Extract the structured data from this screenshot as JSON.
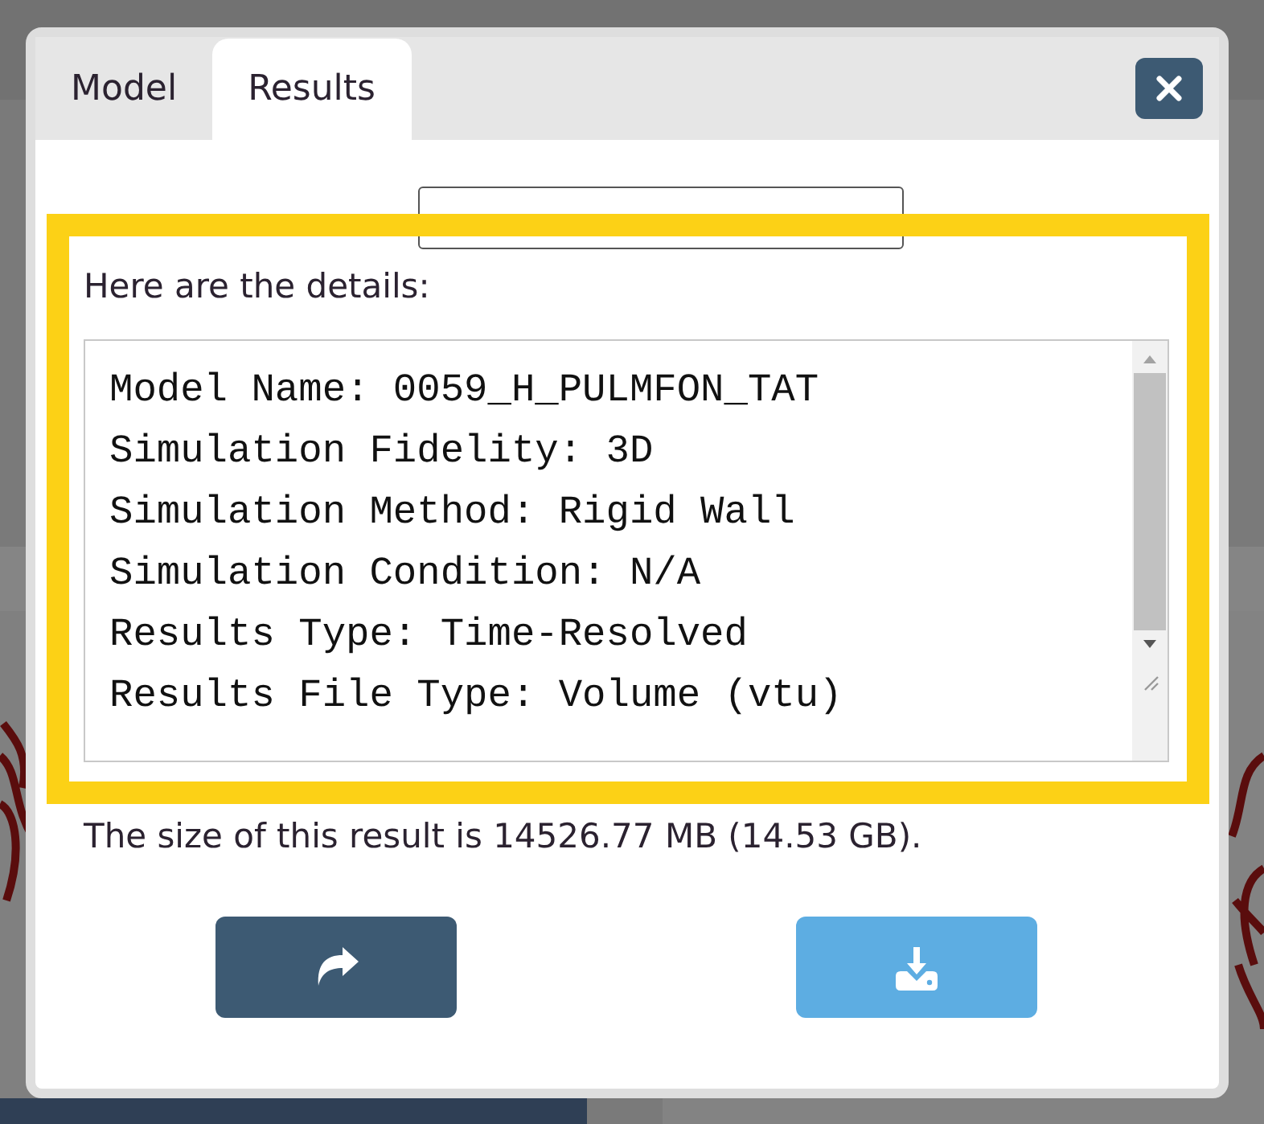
{
  "tabs": [
    {
      "label": "Model",
      "selected": false
    },
    {
      "label": "Results",
      "selected": true
    }
  ],
  "details_heading": "Here are the details:",
  "details_lines": [
    "Model Name: 0059_H_PULMFON_TAT",
    "Simulation Fidelity: 3D",
    "Simulation Method: Rigid Wall",
    "Simulation Condition: N/A",
    "Results Type: Time-Resolved",
    "Results File Type: Volume (vtu)"
  ],
  "size_text": "The size of this result is 14526.77 MB (14.53 GB).",
  "buttons": [
    {
      "kind": "share"
    },
    {
      "kind": "download"
    }
  ]
}
